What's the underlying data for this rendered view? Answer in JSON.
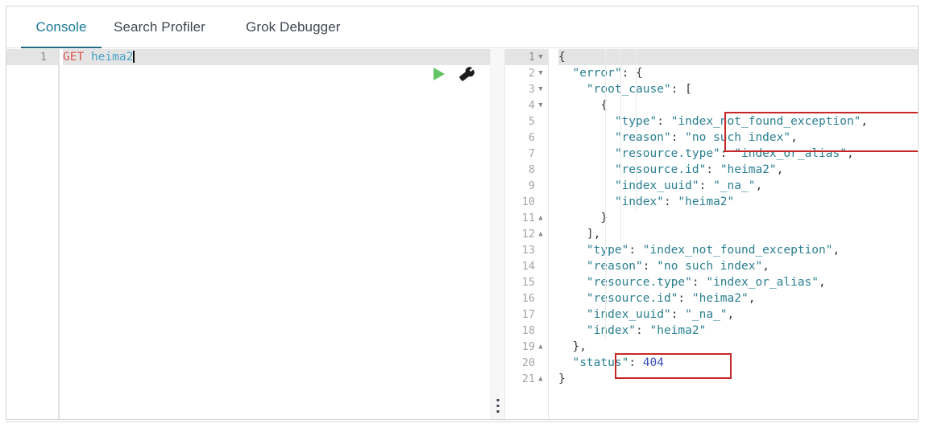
{
  "tabs": [
    {
      "id": "console",
      "label": "Console",
      "active": true
    },
    {
      "id": "search-profiler",
      "label": "Search Profiler",
      "active": false
    },
    {
      "id": "grok-debugger",
      "label": "Grok Debugger",
      "active": false
    }
  ],
  "request_editor": {
    "line_number": "1",
    "method": "GET",
    "path": "heima2",
    "run_icon": "play-icon",
    "settings_icon": "wrench-icon"
  },
  "response_editor": {
    "line_numbers": [
      "1",
      "2",
      "3",
      "4",
      "5",
      "6",
      "7",
      "8",
      "9",
      "10",
      "11",
      "12",
      "13",
      "14",
      "15",
      "16",
      "17",
      "18",
      "19",
      "20",
      "21"
    ],
    "fold_markers": {
      "1": "down",
      "2": "down",
      "3": "down",
      "4": "down",
      "11": "up",
      "12": "up",
      "19": "up",
      "21": "up"
    },
    "lines": [
      "{",
      "  \"error\": {",
      "    \"root_cause\": [",
      "      {",
      "        \"type\": \"index_not_found_exception\",",
      "        \"reason\": \"no such index\",",
      "        \"resource.type\": \"index_or_alias\",",
      "        \"resource.id\": \"heima2\",",
      "        \"index_uuid\": \"_na_\",",
      "        \"index\": \"heima2\"",
      "      }",
      "    ],",
      "    \"type\": \"index_not_found_exception\",",
      "    \"reason\": \"no such index\",",
      "    \"resource.type\": \"index_or_alias\",",
      "    \"resource.id\": \"heima2\",",
      "    \"index_uuid\": \"_na_\",",
      "    \"index\": \"heima2\"",
      "  },",
      "  \"status\": 404",
      "}"
    ],
    "status_code": "404"
  },
  "annotations": [
    {
      "id": "exception-highlight",
      "target": "index_not_found_exception / no such index"
    },
    {
      "id": "status-highlight",
      "target": "\"status\": 404"
    }
  ],
  "splitter": {
    "handle_icon": "drag-handle-icon"
  },
  "colors": {
    "accent_tab": "#1a7896",
    "string": "#2a7f91",
    "number": "#3b4ec0",
    "method": "#d9534f",
    "url": "#4aa3c7",
    "annotation": "#c62828",
    "run": "#62c462"
  }
}
